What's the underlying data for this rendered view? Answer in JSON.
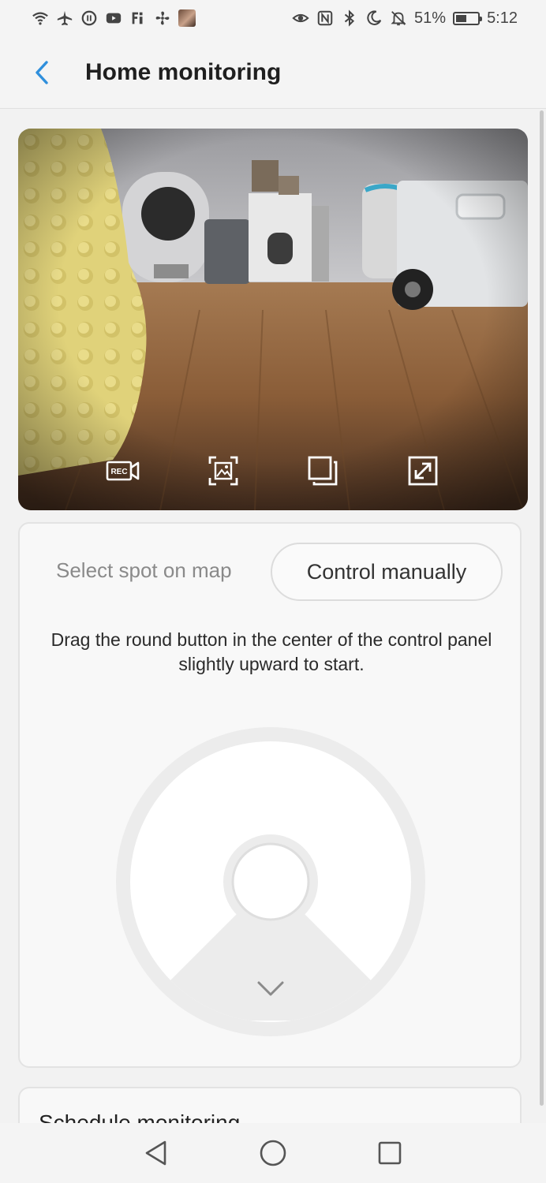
{
  "status_bar": {
    "left_icons": [
      "wifi-icon",
      "airplane-icon",
      "data-saver-icon",
      "youtube-icon",
      "google-fi-icon",
      "fan-icon",
      "avatar"
    ],
    "right_icons": [
      "eye-icon",
      "nfc-icon",
      "bluetooth-icon",
      "moon-icon",
      "bell-off-icon"
    ],
    "battery_percent": "51%",
    "battery_level": 0.51,
    "time": "5:12"
  },
  "header": {
    "title": "Home monitoring",
    "back_icon": "chevron-left-icon",
    "accent_color": "#2f8fdc"
  },
  "camera": {
    "controls": [
      {
        "name": "record-button",
        "icon": "rec-icon",
        "label": "REC"
      },
      {
        "name": "snapshot-button",
        "icon": "image-frame-icon"
      },
      {
        "name": "pip-button",
        "icon": "copy-window-icon"
      },
      {
        "name": "fullscreen-button",
        "icon": "expand-icon"
      }
    ]
  },
  "control_panel": {
    "mode_map_label": "Select spot on map",
    "mode_manual_label": "Control manually",
    "instructions": "Drag the round button in the center of the control panel slightly upward to start.",
    "joystick_icon": "chevron-down-icon"
  },
  "schedule": {
    "title": "Schedule monitoring"
  },
  "nav": {
    "icons": [
      "back-triangle-icon",
      "home-circle-icon",
      "recents-square-icon"
    ]
  }
}
